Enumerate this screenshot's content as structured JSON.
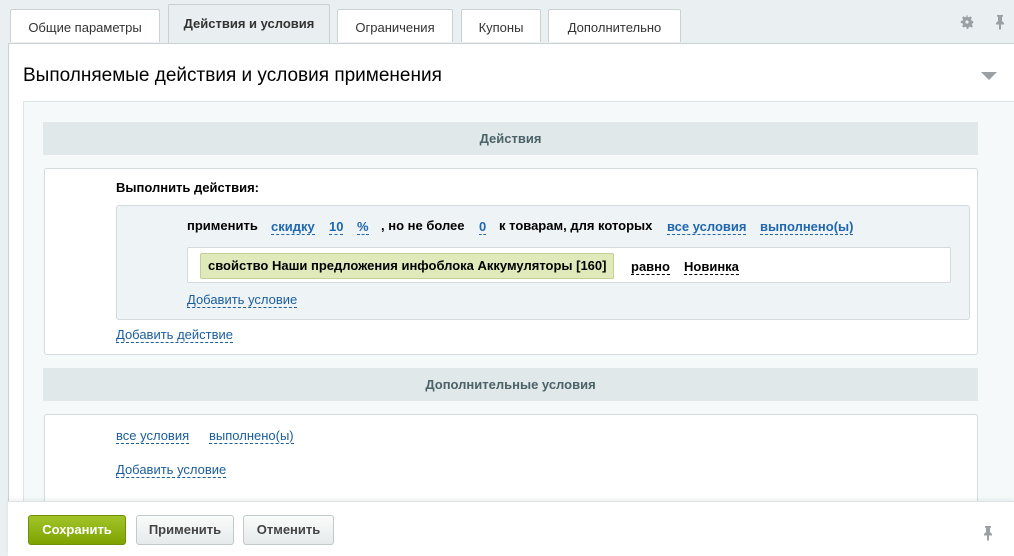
{
  "tabs": [
    {
      "label": "Общие параметры"
    },
    {
      "label": "Действия и условия",
      "active": true
    },
    {
      "label": "Ограничения"
    },
    {
      "label": "Купоны"
    },
    {
      "label": "Дополнительно"
    }
  ],
  "section": {
    "title": "Выполняемые действия и условия применения"
  },
  "actions": {
    "band_title": "Действия",
    "heading": "Выполнить действия:",
    "apply_word": "применить",
    "discount_type": "скидку",
    "discount_value": "10",
    "discount_unit": "%",
    "limit_text": ", но не более",
    "limit_value": "0",
    "goods_text": "к товарам, для которых",
    "all_conditions": "все условия",
    "fulfilled": "выполнено(ы)",
    "condition": {
      "property": "свойство Наши предложения инфоблока Аккумуляторы [160]",
      "operator": "равно",
      "value": "Новинка"
    },
    "add_condition": "Добавить условие",
    "add_action": "Добавить действие"
  },
  "extra": {
    "band_title": "Дополнительные условия",
    "all_conditions": "все условия",
    "fulfilled": "выполнено(ы)",
    "add_condition": "Добавить условие"
  },
  "footer": {
    "save": "Сохранить",
    "apply": "Применить",
    "cancel": "Отменить"
  },
  "colors": {
    "accent_green": "#86ad00",
    "link_blue": "#2067b0",
    "condition_chip": "#dfe9b9"
  },
  "icons": [
    "gear-icon",
    "pin-icon",
    "collapse-arrow-icon"
  ]
}
